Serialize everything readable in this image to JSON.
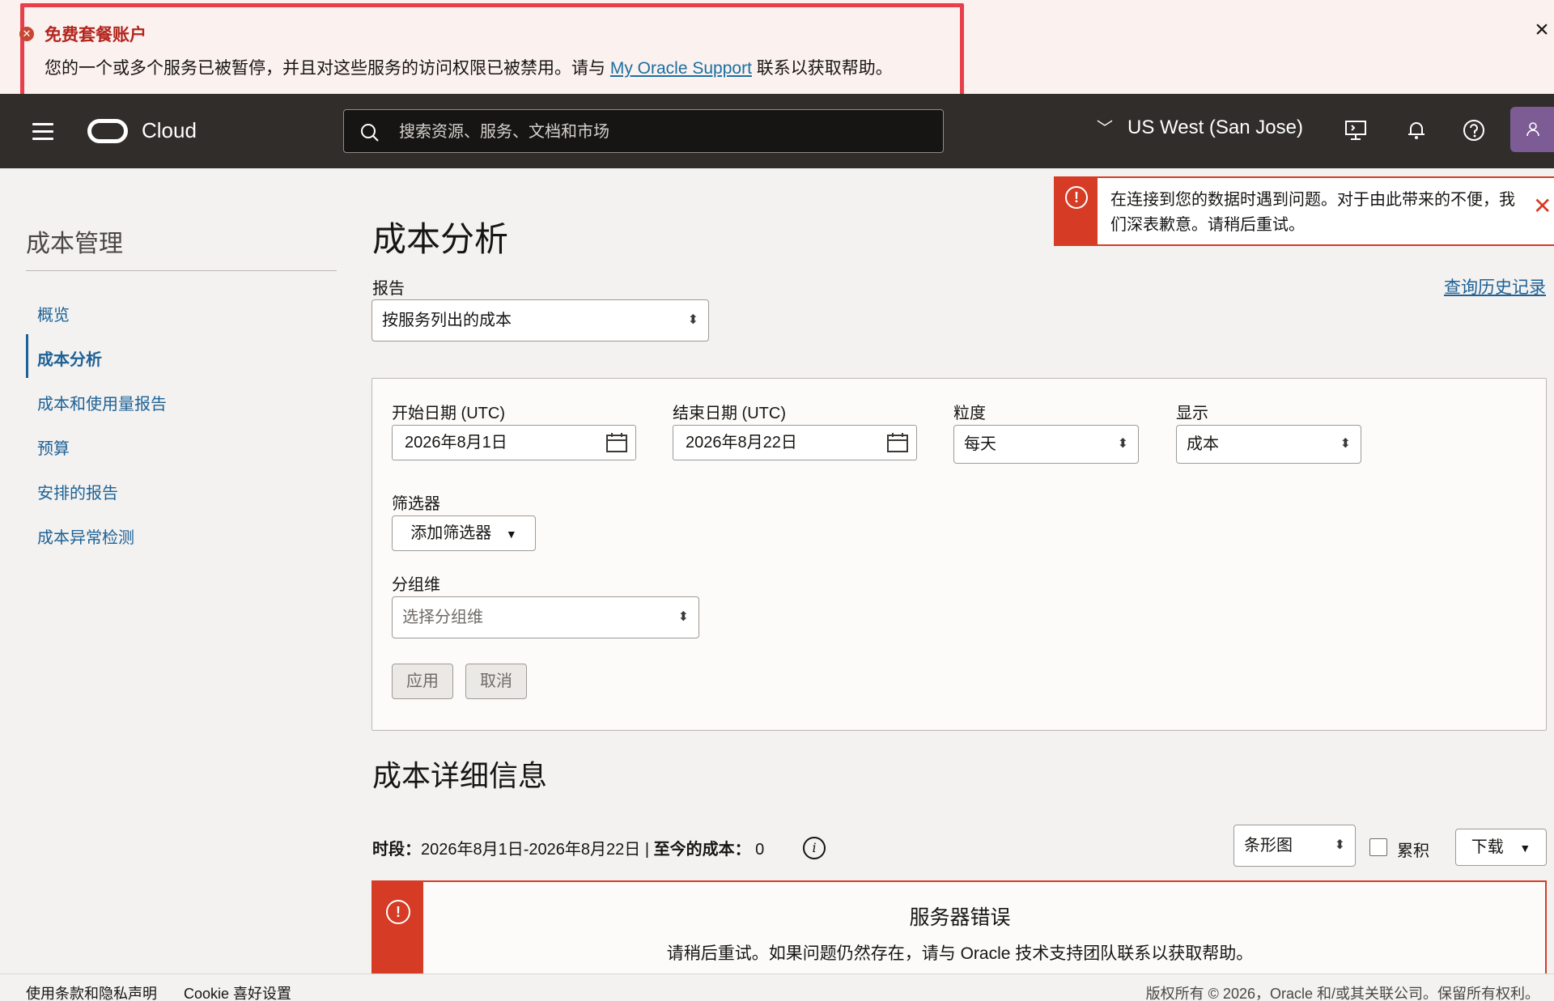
{
  "banner": {
    "title": "免费套餐账户",
    "message_before": "您的一个或多个服务已被暂停，并且对这些服务的访问权限已被禁用。请与 ",
    "link": "My Oracle Support",
    "message_after": " 联系以获取帮助。",
    "close_icon": "×"
  },
  "nav": {
    "brand": "Cloud",
    "search_placeholder": "搜索资源、服务、文档和市场",
    "region": "US West (San Jose)"
  },
  "toast": {
    "message": "在连接到您的数据时遇到问题。对于由此带来的不便，我们深表歉意。请稍后重试。",
    "alert_glyph": "!",
    "close_glyph": "✕"
  },
  "sidebar": {
    "title": "成本管理",
    "items": [
      {
        "label": "概览"
      },
      {
        "label": "成本分析"
      },
      {
        "label": "成本和使用量报告"
      },
      {
        "label": "预算"
      },
      {
        "label": "安排的报告"
      },
      {
        "label": "成本异常检测"
      }
    ]
  },
  "main": {
    "title": "成本分析",
    "report_label": "报告",
    "report_value": "按服务列出的成本",
    "history_link": "查询历史记录",
    "start_label": "开始日期 (UTC)",
    "start_value": "2026年8月1日",
    "end_label": "结束日期 (UTC)",
    "end_value": "2026年8月22日",
    "granularity_label": "粒度",
    "granularity_value": "每天",
    "show_label": "显示",
    "show_value": "成本",
    "filter_label": "筛选器",
    "add_filter": "添加筛选器",
    "group_label": "分组维",
    "group_placeholder": "选择分组维",
    "apply": "应用",
    "cancel": "取消"
  },
  "details": {
    "title": "成本详细信息",
    "period_label": "时段",
    "period_value": "2026年8月1日-2026年8月22日",
    "to_date_label": "至今的成本",
    "to_date_value": "0",
    "chart_type": "条形图",
    "cumulative": "累积",
    "download": "下载",
    "error_title": "服务器错误",
    "error_message": "请稍后重试。如果问题仍然存在，请与 Oracle 技术支持团队联系以获取帮助。"
  },
  "footer": {
    "terms": "使用条款和隐私声明",
    "cookie": "Cookie 喜好设置",
    "copyright": "版权所有 © 2026，Oracle 和/或其关联公司。保留所有权利。"
  },
  "colors": {
    "error_red": "#d63b25",
    "link_blue": "#1d6196",
    "nav_bg": "#312d2a",
    "avatar_purple": "#7d5c96"
  }
}
